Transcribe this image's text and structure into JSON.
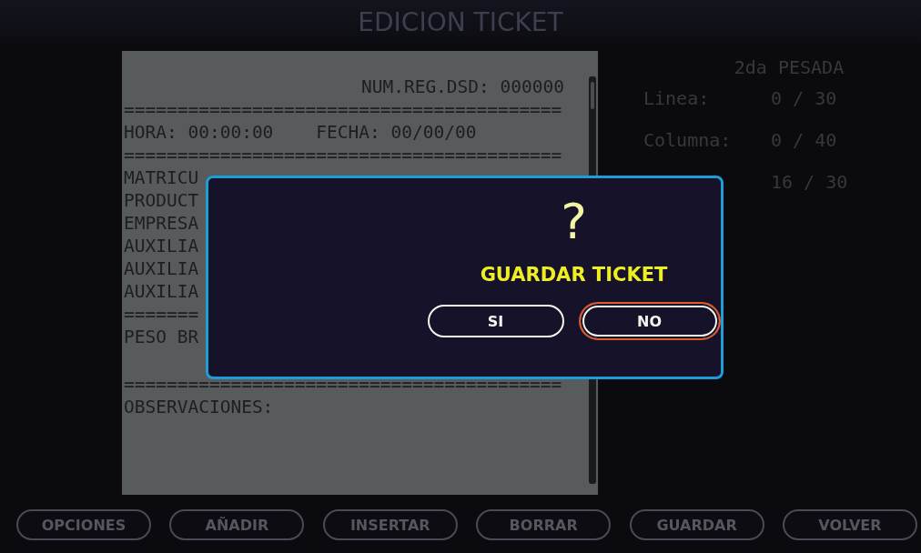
{
  "window": {
    "title": "EDICION TICKET"
  },
  "ticket": {
    "header": "NUM.REG.DSD: 000000",
    "lines": [
      "=========================================",
      "HORA: 00:00:00    FECHA: 00/00/00",
      "=========================================",
      "MATRICU",
      "PRODUCT",
      "EMPRESA",
      "AUXILIA",
      "AUXILIA",
      "AUXILIA",
      "=======",
      "PESO BR"
    ],
    "footer_lines": [
      "=========================================",
      "OBSERVACIONES:"
    ]
  },
  "info": {
    "title": "2da PESADA",
    "rows": [
      {
        "label": "Linea:",
        "value": "0 / 30"
      },
      {
        "label": "Columna:",
        "value": "0 / 40"
      },
      {
        "value": "16 / 30"
      }
    ]
  },
  "dialog": {
    "icon": "?",
    "message": "GUARDAR TICKET",
    "buttons": [
      {
        "label": "SI",
        "selected": false
      },
      {
        "label": "NO",
        "selected": true
      }
    ]
  },
  "toolbar": [
    "OPCIONES",
    "AÑADIR",
    "INSERTAR",
    "BORRAR",
    "GUARDAR",
    "VOLVER"
  ]
}
